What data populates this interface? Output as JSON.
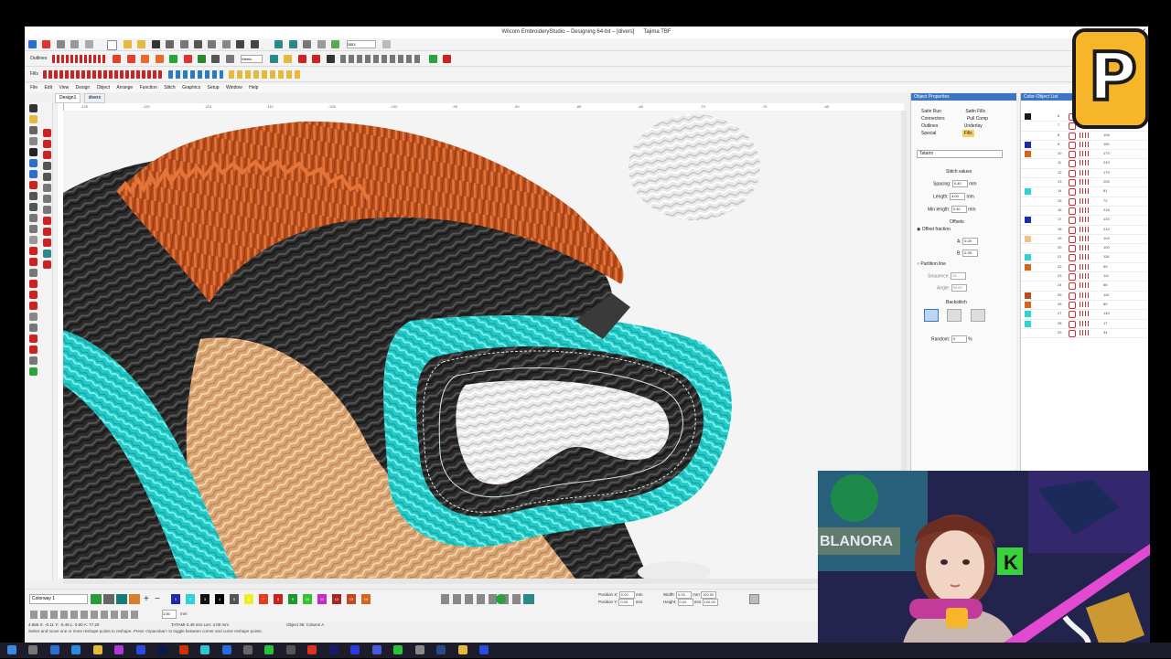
{
  "window": {
    "title": "Wilcom EmbroideryStudio – Designing 64-bit – [divers]",
    "machine": "Tajima TBF",
    "close_glyph": "✕"
  },
  "toolbar": {
    "zoom_value": "3553",
    "outlines_label": "Outlines",
    "fills_label": "Fills",
    "units_value": "Metric"
  },
  "menu": [
    "File",
    "Edit",
    "View",
    "Design",
    "Object",
    "Arrange",
    "Function",
    "Stitch",
    "Graphics",
    "Setup",
    "Window",
    "Help"
  ],
  "doc_tabs": [
    "Design1",
    "divers"
  ],
  "ruler_h_labels": [
    "-125",
    "-120",
    "-115",
    "-110",
    "-105",
    "-100",
    "-95",
    "-90",
    "-85",
    "-80",
    "-75",
    "-70",
    "-65"
  ],
  "object_properties": {
    "title": "Object Properties",
    "tabs": [
      "Satin Run",
      "Connectors",
      "Outlines",
      "Special",
      "Satin Fills",
      "Pull Comp",
      "Underlay",
      "Fills"
    ],
    "fill_type": "Tatami",
    "section_stitch": "Stitch values",
    "spacing_label": "Spacing:",
    "spacing_value": "0.40",
    "length_label": "Length:",
    "length_value": "4.00",
    "minlength_label": "Min length:",
    "minlength_value": "0.40",
    "unit_mm": "mm",
    "section_offsets": "Offsets",
    "offset_fraction_label": "Offset fraction",
    "a_label": "A:",
    "a_value": "0.25",
    "b_label": "B:",
    "b_value": "0.25",
    "partition_label": "Partition line",
    "sequence_label": "Sequence:",
    "sequence_value": "01",
    "angle_label": "Angle:",
    "angle_value": "90.00",
    "backstitch_label": "Backstitch",
    "random_label": "Random:",
    "random_value": "0",
    "percent": "%"
  },
  "color_list": {
    "title": "Color-Object List",
    "rows": [
      {
        "color": "#1a1a1a",
        "num": "6",
        "val": ""
      },
      {
        "color": "",
        "num": "7",
        "val": "76"
      },
      {
        "color": "",
        "num": "8",
        "val": "106"
      },
      {
        "color": "#1f2aa8",
        "num": "9",
        "val": "150"
      },
      {
        "color": "#d7641e",
        "num": "10",
        "val": "173"
      },
      {
        "color": "",
        "num": "11",
        "val": "210"
      },
      {
        "color": "",
        "num": "12",
        "val": "179"
      },
      {
        "color": "",
        "num": "13",
        "val": "205"
      },
      {
        "color": "#2fd3d1",
        "num": "14",
        "val": "81"
      },
      {
        "color": "",
        "num": "15",
        "val": "72"
      },
      {
        "color": "",
        "num": "16",
        "val": "218"
      },
      {
        "color": "#1f2aa8",
        "num": "17",
        "val": "133"
      },
      {
        "color": "",
        "num": "18",
        "val": "214"
      },
      {
        "color": "#f2c08a",
        "num": "19",
        "val": "104"
      },
      {
        "color": "",
        "num": "20",
        "val": "100"
      },
      {
        "color": "#2fd3d1",
        "num": "21",
        "val": "118"
      },
      {
        "color": "#d7641e",
        "num": "22",
        "val": "99"
      },
      {
        "color": "",
        "num": "23",
        "val": "111"
      },
      {
        "color": "",
        "num": "24",
        "val": "66"
      },
      {
        "color": "#c0481b",
        "num": "25",
        "val": "110"
      },
      {
        "color": "#d7641e",
        "num": "26",
        "val": "89"
      },
      {
        "color": "#2fd3d1",
        "num": "27",
        "val": "145"
      },
      {
        "color": "#2fd3d1",
        "num": "28",
        "val": "17"
      },
      {
        "color": "",
        "num": "29",
        "val": "34"
      }
    ]
  },
  "bottom": {
    "colorway": "Colorway 1",
    "palette": [
      {
        "num": "1",
        "color": "#1f2aa8"
      },
      {
        "num": "2",
        "color": "#2fd3d1"
      },
      {
        "num": "3",
        "color": "#111111"
      },
      {
        "num": "4",
        "color": "#000000"
      },
      {
        "num": "5",
        "color": "#555555"
      },
      {
        "num": "6",
        "color": "#eeee22"
      },
      {
        "num": "7",
        "color": "#e83a1e"
      },
      {
        "num": "8",
        "color": "#c81f1f"
      },
      {
        "num": "9",
        "color": "#1a9a2a"
      },
      {
        "num": "10",
        "color": "#2ec52e"
      },
      {
        "num": "11",
        "color": "#c22ec2"
      },
      {
        "num": "12",
        "color": "#aa2222"
      },
      {
        "num": "13",
        "color": "#c0481b"
      },
      {
        "num": "14",
        "color": "#d7641e"
      }
    ],
    "position_x_label": "Position X:",
    "position_y_label": "Position Y:",
    "pos_x": "0.00",
    "pos_y": "0.00",
    "width_label": "Width:",
    "height_label": "Height:",
    "width_val": "0.00",
    "height_val": "0.00",
    "w_pct": "100.00",
    "h_pct": "100.00",
    "size_value": "1.00",
    "unit_mm": "mm"
  },
  "status": {
    "coords": "4.565   X: -0.11 Y: -0.49 L: 0.50 A: 77.20",
    "stitch_info": "TATAMI  0.40 mm  Len: 4.00 mm",
    "object_info": "Object 35: Column A",
    "hint": "Select and move one or more reshape points to reshape. Press <Spacebar> to toggle between corner and curve reshape points."
  },
  "webcam": {
    "sign_text": "BLANORA",
    "badge_letter": "K"
  },
  "logo_letter": "P"
}
